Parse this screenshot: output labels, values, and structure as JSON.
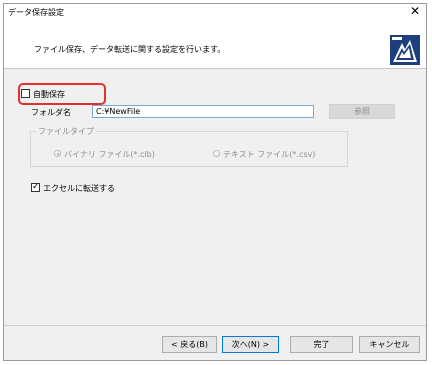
{
  "window": {
    "title": "データ保存設定",
    "close_glyph": "✕"
  },
  "header": {
    "description": "ファイル保存、データ転送に関する設定を行います。"
  },
  "autosave": {
    "label": "自動保存",
    "checked": false
  },
  "folder": {
    "label": "フォルダ名",
    "value": "C:¥NewFile",
    "browse_label": "参照"
  },
  "filetype": {
    "group_title": "ファイルタイプ",
    "options": [
      {
        "label": "バイナリ ファイル(*.clb)",
        "selected": true
      },
      {
        "label": "テキスト ファイル(*.csv)",
        "selected": false
      }
    ]
  },
  "excel": {
    "label": "エクセルに転送する",
    "checked": true,
    "check_glyph": "✓"
  },
  "buttons": {
    "back": "< 戻る(B)",
    "next": "次へ(N) >",
    "finish": "完了",
    "cancel": "キャンセル"
  }
}
